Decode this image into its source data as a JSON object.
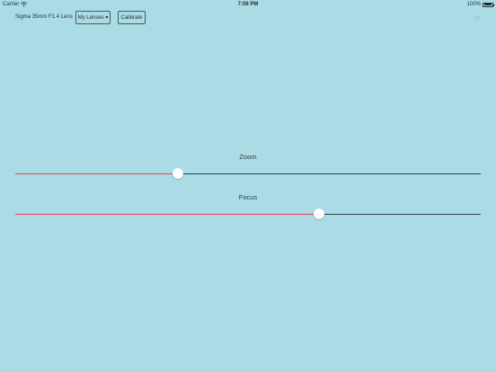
{
  "status_bar": {
    "carrier": "Carrier",
    "time": "7:08 PM",
    "battery": "100%"
  },
  "toolbar": {
    "lens_name": "Sigma 35mm F1.4 Lens",
    "my_lenses_label": "My Lenses ▾",
    "calibrate_label": "Calibrate"
  },
  "sliders": [
    {
      "label": "Zoom",
      "value": 0.35
    },
    {
      "label": "Focus",
      "value": 0.652
    }
  ],
  "colors": {
    "background": "#abdce5",
    "slider_fill": "#e0475a",
    "slider_track": "#2f4048",
    "thumb": "#ffffff"
  }
}
